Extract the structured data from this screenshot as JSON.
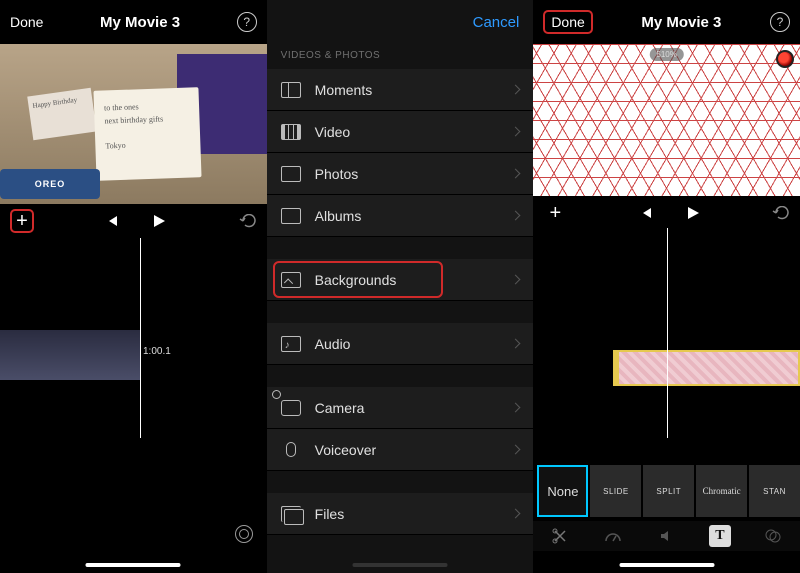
{
  "panel1": {
    "done_label": "Done",
    "title": "My Movie 3",
    "clip_duration": "1:00.1",
    "greeting_card": "Happy Birthday",
    "oreo_label": "OREO"
  },
  "panel2": {
    "cancel_label": "Cancel",
    "section_header": "VIDEOS & PHOTOS",
    "items": [
      {
        "label": "Moments"
      },
      {
        "label": "Video"
      },
      {
        "label": "Photos"
      },
      {
        "label": "Albums"
      },
      {
        "label": "Backgrounds"
      },
      {
        "label": "Audio"
      },
      {
        "label": "Camera"
      },
      {
        "label": "Voiceover"
      },
      {
        "label": "Files"
      }
    ]
  },
  "panel3": {
    "done_label": "Done",
    "title": "My Movie 3",
    "zoom_label": "510%",
    "title_tiles": [
      {
        "label": "None"
      },
      {
        "label": "SLIDE"
      },
      {
        "label": "SPLIT"
      },
      {
        "label": "Chromatic"
      },
      {
        "label": "STAN"
      }
    ]
  }
}
